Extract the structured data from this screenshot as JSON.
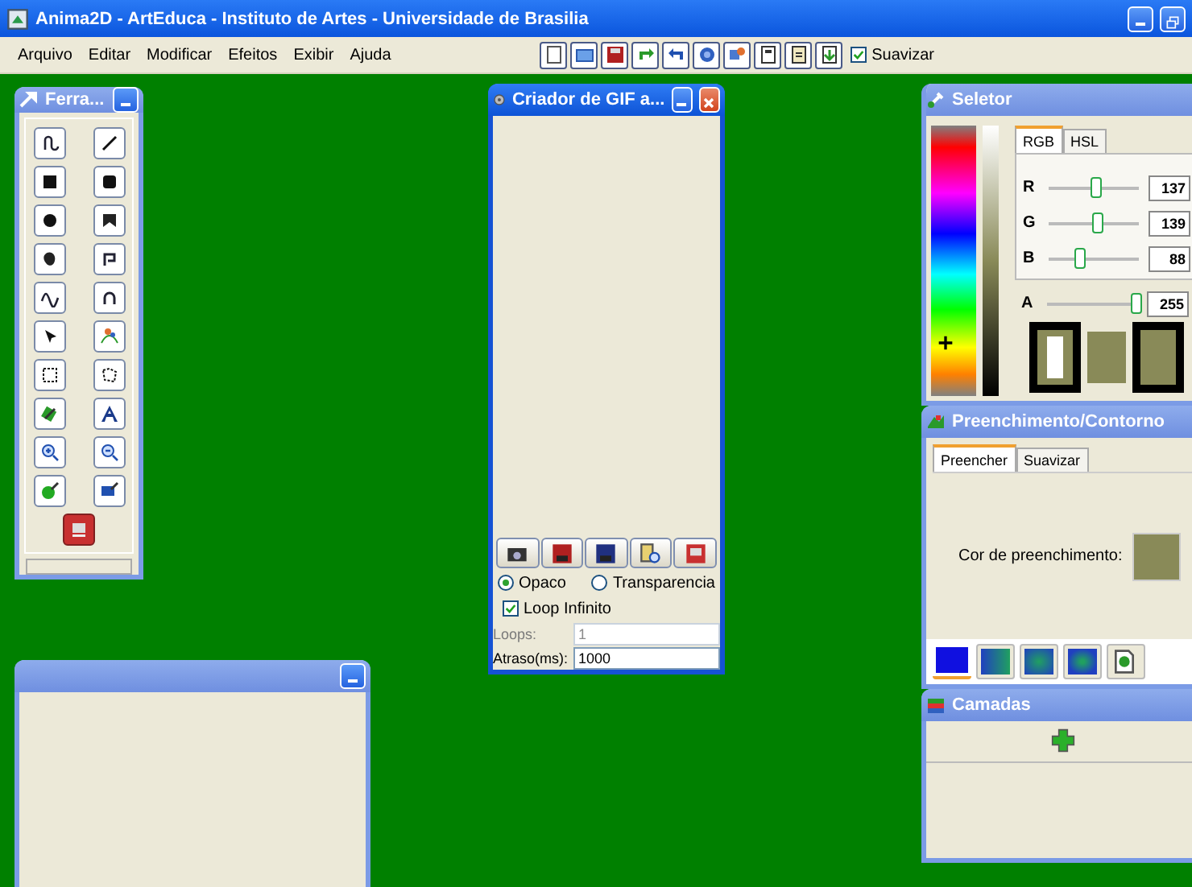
{
  "app": {
    "title": "Anima2D - ArtEduca - Instituto de Artes - Universidade de Brasilia"
  },
  "menu": [
    "Arquivo",
    "Editar",
    "Modificar",
    "Efeitos",
    "Exibir",
    "Ajuda"
  ],
  "toolbar": {
    "smooth": {
      "label": "Suavizar",
      "checked": true
    }
  },
  "tools_window": {
    "title": "Ferra..."
  },
  "gif_window": {
    "title": "Criador de GIF a...",
    "modes": [
      {
        "label": "Opaco",
        "selected": true
      },
      {
        "label": "Transparencia",
        "selected": false
      }
    ],
    "loop": {
      "label": "Loop Infinito",
      "checked": true
    },
    "loops": {
      "label": "Loops:",
      "value": "1",
      "disabled": true
    },
    "delay": {
      "label": "Atraso(ms):",
      "value": "1000"
    }
  },
  "selector": {
    "title": "Seletor",
    "tabs": [
      {
        "label": "RGB",
        "selected": true
      },
      {
        "label": "HSL",
        "selected": false
      }
    ],
    "channels": [
      {
        "name": "R",
        "value": "137",
        "level": 0.54
      },
      {
        "name": "G",
        "value": "139",
        "level": 0.55
      },
      {
        "name": "B",
        "value": "88",
        "level": 0.35
      },
      {
        "name": "A",
        "value": "255",
        "level": 1
      }
    ]
  },
  "fill": {
    "title": "Preenchimento/Contorno",
    "tabs": [
      {
        "label": "Preencher",
        "selected": true
      },
      {
        "label": "Suavizar",
        "selected": false
      }
    ],
    "color_label": "Cor de preenchimento:",
    "fill_types": [
      {
        "kind": "solid",
        "selected": true
      },
      {
        "kind": "linear",
        "selected": false
      },
      {
        "kind": "radial",
        "selected": false
      },
      {
        "kind": "square",
        "selected": false
      },
      {
        "kind": "texture",
        "selected": false
      }
    ]
  },
  "layers": {
    "title": "Camadas"
  }
}
